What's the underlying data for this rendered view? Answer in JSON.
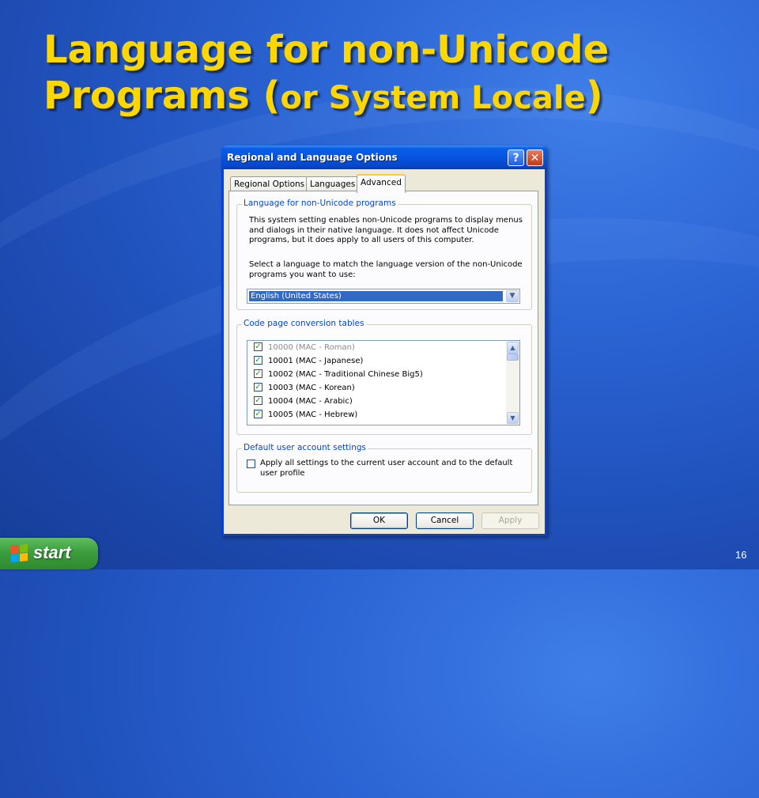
{
  "slide": {
    "title_line1": "Language for non-Unicode",
    "title_line2_main": "Programs (",
    "title_line2_small": "or System Locale",
    "title_line2_end": ")",
    "page_number": "16"
  },
  "dialog": {
    "title": "Regional and Language Options",
    "help_glyph": "?",
    "close_glyph": "✕",
    "tabs": [
      "Regional Options",
      "Languages",
      "Advanced"
    ],
    "active_tab": "Advanced",
    "group1": {
      "label": "Language for non-Unicode programs",
      "description_lines": [
        "This system setting enables non-Unicode programs to display menus",
        "and dialogs in their native language. It does not affect Unicode",
        "programs, but it does apply to all users of this computer."
      ],
      "prompt_lines": [
        "Select a language to match the language version of the non-Unicode",
        "programs you want to use:"
      ],
      "combo_value": "English (United States)",
      "combo_arrow": "▼"
    },
    "group2": {
      "label": "Code page conversion tables",
      "items": [
        {
          "label": "10000 (MAC - Roman)",
          "checked": true,
          "disabled": true
        },
        {
          "label": "10001 (MAC - Japanese)",
          "checked": true,
          "disabled": false
        },
        {
          "label": "10002 (MAC - Traditional Chinese Big5)",
          "checked": true,
          "disabled": false
        },
        {
          "label": "10003 (MAC - Korean)",
          "checked": true,
          "disabled": false
        },
        {
          "label": "10004 (MAC - Arabic)",
          "checked": true,
          "disabled": false
        },
        {
          "label": "10005 (MAC - Hebrew)",
          "checked": true,
          "disabled": false
        }
      ],
      "scroll_up": "▲",
      "scroll_down": "▼"
    },
    "group3": {
      "label": "Default user account settings",
      "checkbox_label_line1": "Apply all settings to the current user account and to the default",
      "checkbox_label_line2": "user profile",
      "checked": false
    },
    "buttons": {
      "ok": "OK",
      "cancel": "Cancel",
      "apply": "Apply"
    }
  },
  "taskbar": {
    "start_label": "start",
    "logo_colors": [
      "#f35325",
      "#81bc06",
      "#05a6f0",
      "#ffba08"
    ]
  },
  "colors": {
    "title_yellow": "#ffd700",
    "xp_blue_titlebar": "#0554e0",
    "dialog_face": "#ece9d8",
    "selection_blue": "#316ac5",
    "check_green": "#21a121"
  }
}
